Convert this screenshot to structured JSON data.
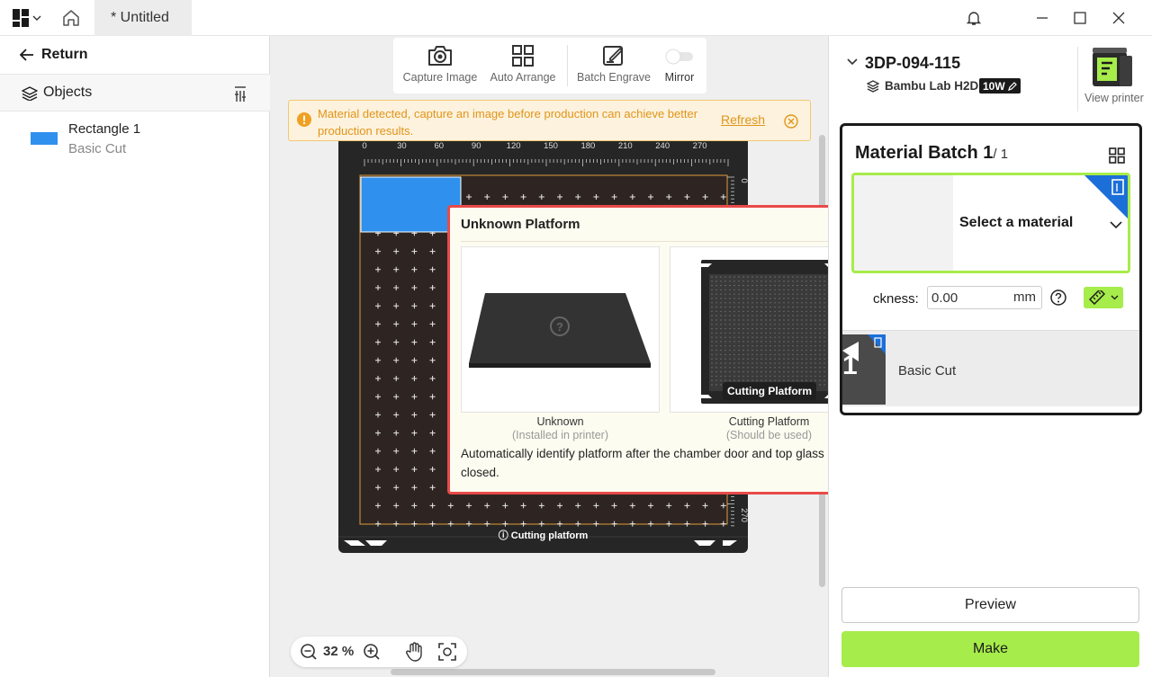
{
  "titlebar": {
    "tab_title": "* Untitled",
    "icons": [
      "logo-icon",
      "chevron-down-icon",
      "home-icon",
      "bell-icon",
      "minimize-icon",
      "maximize-icon",
      "close-icon"
    ]
  },
  "left_panel": {
    "return_label": "Return",
    "objects_label": "Objects",
    "objects": [
      {
        "name": "Rectangle 1",
        "sub": "Basic Cut",
        "color": "#2f90ee"
      }
    ]
  },
  "toolbar": {
    "capture": "Capture Image",
    "auto_arrange": "Auto Arrange",
    "batch_engrave": "Batch Engrave",
    "mirror": "Mirror",
    "mirror_on": false
  },
  "notice": {
    "text": "Material detected, capture an image before production can achieve better production results.",
    "action": "Refresh",
    "color": "#e0951a"
  },
  "plate": {
    "label": "Cutting platform",
    "ruler_top": [
      "0",
      "30",
      "60",
      "90",
      "120",
      "150",
      "180",
      "210",
      "240",
      "270"
    ],
    "ruler_right": [
      "0",
      "270"
    ]
  },
  "zoom": {
    "value": "32 %"
  },
  "popup": {
    "title": "Unknown Platform",
    "platforms": [
      {
        "name": "Unknown",
        "sub": "(Installed in printer)"
      },
      {
        "name": "Cutting Platform",
        "sub": "(Should be used)",
        "tag": "Cutting Platform"
      }
    ],
    "description": "Automatically identify platform after the chamber door and top glass cover is closed."
  },
  "right_panel": {
    "printer_name": "3DP-094-115",
    "printer_model": "Bambu Lab H2D",
    "power": "10W",
    "view_printer": "View printer",
    "batch": {
      "title": "Material Batch 1",
      "count": "/ 1",
      "select_material": "Select a material",
      "thickness_label": "ckness:",
      "thickness_value": "0.00",
      "thickness_unit": "mm",
      "step_number": "1",
      "process": "Basic Cut"
    },
    "preview_label": "Preview",
    "make_label": "Make",
    "accent": "#a6ec4a"
  }
}
